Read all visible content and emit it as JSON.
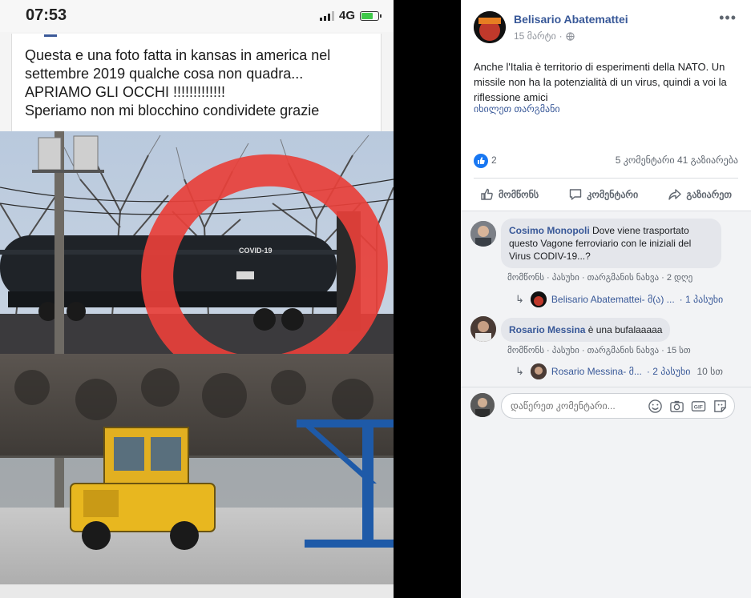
{
  "phone": {
    "status_time": "07:53",
    "network": "4G",
    "post_lines": [
      "Questa e una foto fatta in kansas in america nel",
      "settembre 2019 qualche cosa non quadra...",
      "APRIAMO GLI OCCHI !!!!!!!!!!!!!",
      "Speriamo non mi blocchino condividete grazie"
    ],
    "photo": {
      "tanker_label": "COVID-19",
      "highlight_color": "#e8403a"
    }
  },
  "post": {
    "author": "Belisario Abatemattei",
    "date": "15 მარტი",
    "body": "Anche l'Italia è territorio di esperimenti della NATO. Un missile non ha la potenzialità di un virus, quindi a voi la riflessione amici",
    "translate": "იხილეთ თარგმანი",
    "like_count": "2",
    "comments_count": "5 კომენტარი",
    "shares_count": "41 გაზიარება",
    "actions": {
      "like": "მომწონს",
      "comment": "კომენტარი",
      "share": "გაზიარეთ"
    }
  },
  "comments": [
    {
      "name": "Cosimo Monopoli",
      "text_lines": [
        "Dove viene trasportato",
        "questo Vagone ferroviario con le iniziali del",
        "Virus CODIV-19...?"
      ],
      "actions": "მომწონს · პასუხი · თარგმანის ნახვა · 2 დღე",
      "reply": {
        "name": "Belisario Abatemattei",
        "snippet": "- მ(ა) ...",
        "count": "· 1 პასუხი",
        "time": ""
      }
    },
    {
      "name": "Rosario Messina",
      "text_lines": [
        "è una bufalaaaaa"
      ],
      "actions": "მომწონს · პასუხი · თარგმანის ნახვა · 15 სთ",
      "reply": {
        "name": "Rosario Messina",
        "snippet": "- მ...",
        "count": "· 2 პასუხი",
        "time": "10 სთ"
      }
    }
  ],
  "write": {
    "placeholder": "დაწერეთ კომენტარი..."
  },
  "colors": {
    "link": "#385898",
    "like_blue": "#1877f2"
  },
  "icons": [
    "globe-icon",
    "more-icon",
    "like-icon",
    "comment-icon",
    "share-icon",
    "reply-arrow-icon",
    "emoji-icon",
    "camera-icon",
    "gif-icon",
    "sticker-icon"
  ]
}
